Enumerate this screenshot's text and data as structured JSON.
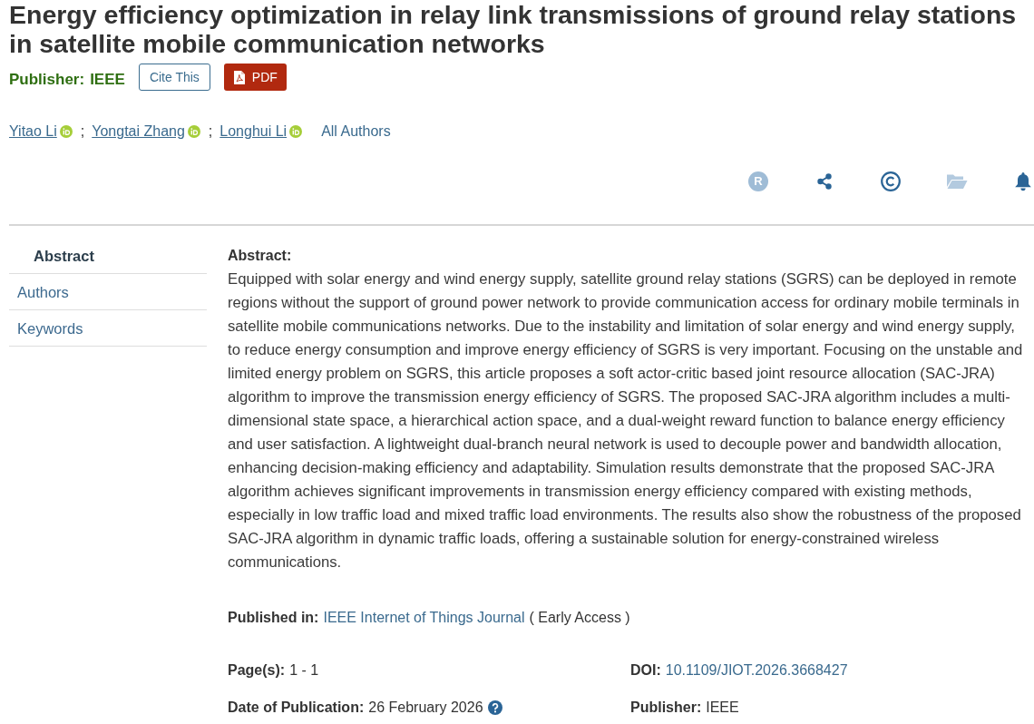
{
  "article": {
    "title": "Energy efficiency optimization in relay link transmissions of ground relay stations in satellite mobile communication networks",
    "publisher_label": "Publisher:",
    "publisher": "IEEE"
  },
  "buttons": [
    {
      "label": "Cite This",
      "kind": "outline"
    },
    {
      "label": "PDF",
      "kind": "pdf"
    }
  ],
  "authors": [
    {
      "name": "Yitao Li",
      "orcid": true,
      "separator": ";"
    },
    {
      "name": "Yongtai Zhang",
      "orcid": true,
      "separator": ";"
    },
    {
      "name": "Longhui Li",
      "orcid": true
    }
  ],
  "all_authors": "All Authors",
  "toolbar": [
    {
      "kind": "rights",
      "glyph": "R",
      "disabled": true
    },
    {
      "kind": "share",
      "disabled": false
    },
    {
      "kind": "copyright",
      "disabled": false
    },
    {
      "kind": "folder",
      "disabled": true
    },
    {
      "kind": "alert",
      "disabled": false
    }
  ],
  "nav": [
    {
      "label": "Abstract",
      "selected": true
    },
    {
      "label": "Authors",
      "selected": false
    },
    {
      "label": "Keywords",
      "selected": false
    }
  ],
  "abstract": {
    "heading": "Abstract:",
    "text": "Equipped with solar energy and wind energy supply, satellite ground relay stations (SGRS) can be deployed in remote regions without the support of ground power network to provide communication access for ordinary mobile terminals in satellite mobile communications networks. Due to the instability and limitation of solar energy and wind energy supply, to reduce energy consumption and improve energy efficiency of SGRS is very important. Focusing on the unstable and limited energy problem on SGRS, this article proposes a soft actor-critic based joint resource allocation (SAC-JRA) algorithm to improve the transmission energy efficiency of SGRS. The proposed SAC-JRA algorithm includes a multi-dimensional state space, a hierarchical action space, and a dual-weight reward function to balance energy efficiency and user satisfaction. A lightweight dual-branch neural network is used to decouple power and bandwidth allocation, enhancing decision-making efficiency and adaptability. Simulation results demonstrate that the proposed SAC-JRA algorithm achieves significant improvements in transmission energy efficiency compared with existing methods, especially in low traffic load and mixed traffic load environments. The results also show the robustness of the proposed SAC-JRA algorithm in dynamic traffic loads, offering a sustainable solution for energy-constrained wireless communications."
  },
  "published_in": {
    "label": "Published in:",
    "journal": "IEEE Internet of Things Journal",
    "status": "( Early Access )"
  },
  "details": [
    {
      "label": "Page(s):",
      "value": "1 - 1",
      "kind": "text"
    },
    {
      "label": "DOI:",
      "value": "10.1109/JIOT.2026.3668427",
      "kind": "link"
    },
    {
      "label": "Date of Publication:",
      "value": "26 February 2026",
      "kind": "help"
    },
    {
      "label": "Publisher:",
      "value": "IEEE",
      "kind": "text"
    }
  ]
}
